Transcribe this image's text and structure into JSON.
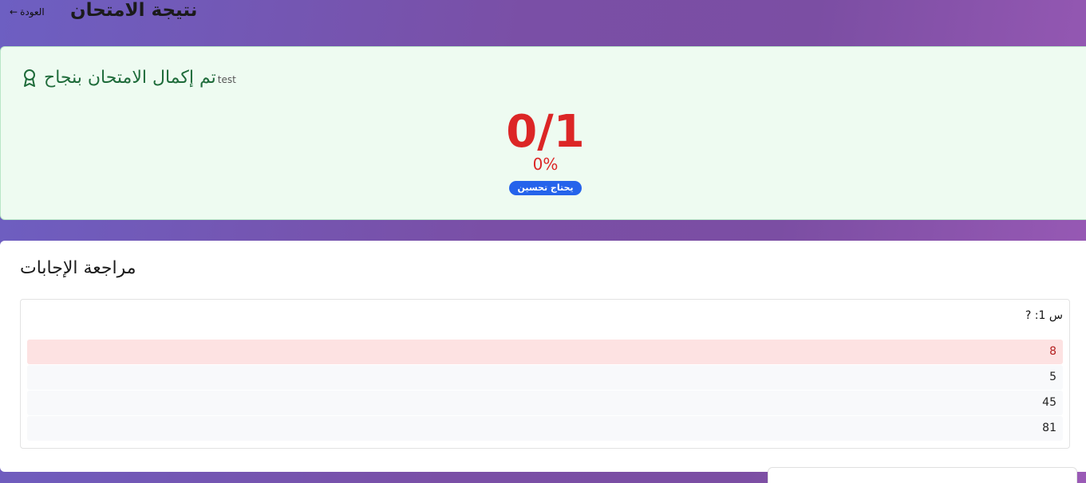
{
  "header": {
    "back_label": "العودة",
    "back_arrow": "←",
    "title": "نتيجة الامتحان"
  },
  "result": {
    "icon": "award-icon",
    "exam_name": "test",
    "heading": "تم إكمال الامتحان بنجاح",
    "score": "0/1",
    "percent": "0%",
    "badge": "يحتاج تحسين"
  },
  "review": {
    "title": "مراجعة الإجابات",
    "question": "س 1: ?",
    "options": [
      {
        "text": "8",
        "state": "wrong"
      },
      {
        "text": "5",
        "state": "normal"
      },
      {
        "text": "45",
        "state": "normal"
      },
      {
        "text": "81",
        "state": "normal"
      }
    ]
  },
  "colors": {
    "score": "#dc2626",
    "success_text": "#1e6b3a",
    "badge": "#2563eb",
    "wrong_bg": "#fde2e2"
  }
}
